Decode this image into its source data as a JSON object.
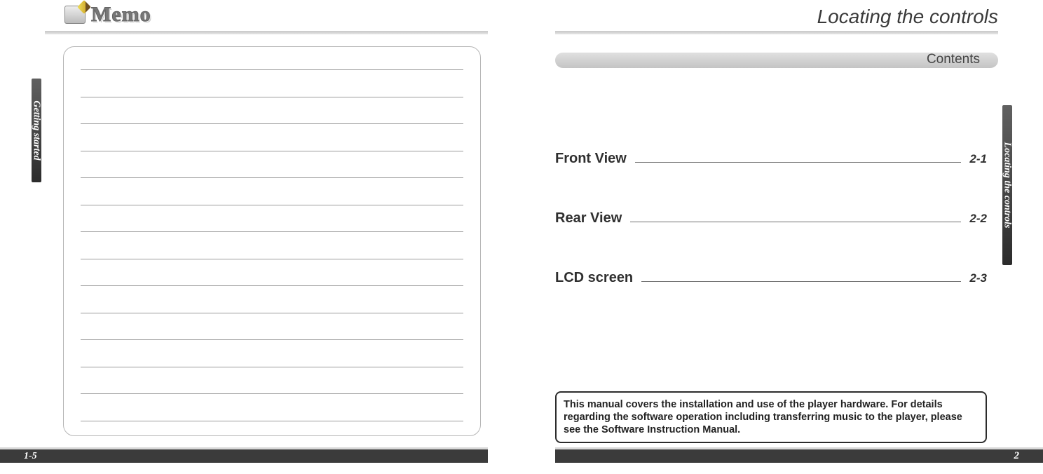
{
  "left": {
    "memo_title": "Memo",
    "side_tab": "Getting started",
    "page_num": "1-5",
    "memo_line_count": 14
  },
  "right": {
    "title": "Locating the controls",
    "contents_label": "Contents",
    "side_tab": "Locating the controls",
    "toc": [
      {
        "label": "Front View",
        "page": "2-1"
      },
      {
        "label": "Rear View",
        "page": "2-2"
      },
      {
        "label": "LCD screen",
        "page": "2-3"
      }
    ],
    "notice": "This manual covers the installation and use of the player hardware.   For details regarding the software operation including transferring music to the player, please see the Software Instruction Manual.",
    "page_num": "2"
  }
}
